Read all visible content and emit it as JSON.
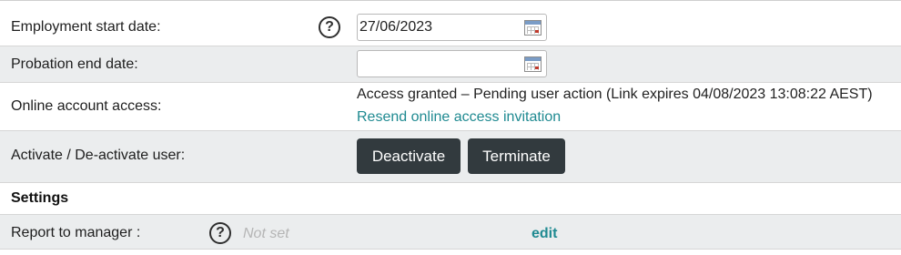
{
  "employment_start_date": {
    "label": "Employment start date:",
    "value": "27/06/2023",
    "help_icon": "question-circle-icon",
    "calendar_icon": "calendar-icon"
  },
  "probation_end_date": {
    "label": "Probation end date:",
    "value": "",
    "calendar_icon": "calendar-icon"
  },
  "online_account_access": {
    "label": "Online account access:",
    "status": "Access granted – Pending user action (Link expires 04/08/2023 13:08:22 AEST)",
    "resend_link": "Resend online access invitation"
  },
  "activate_user": {
    "label": "Activate / De-activate user:",
    "deactivate_label": "Deactivate",
    "terminate_label": "Terminate"
  },
  "settings": {
    "heading": "Settings"
  },
  "report_to_manager": {
    "label": "Report to manager :",
    "value": "Not set",
    "edit_label": "edit",
    "help_icon": "question-circle-icon"
  },
  "colors": {
    "link": "#1f8a91",
    "button_bg": "#323a3e",
    "row_shade": "#ebedee"
  }
}
